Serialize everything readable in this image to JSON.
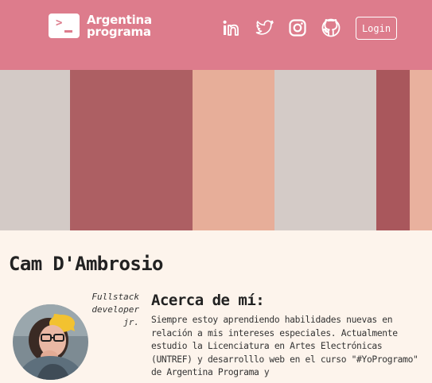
{
  "brand": {
    "line1": "Argentina",
    "line2": "programa",
    "icon": "terminal-prompt-icon",
    "prompt_glyph": ">"
  },
  "nav": {
    "social": [
      {
        "name": "linkedin",
        "icon": "linkedin-icon"
      },
      {
        "name": "twitter",
        "icon": "twitter-icon"
      },
      {
        "name": "instagram",
        "icon": "instagram-icon"
      },
      {
        "name": "github",
        "icon": "github-icon"
      }
    ],
    "login_label": "Login"
  },
  "banner": {
    "stripe_colors": [
      "#d3cac6",
      "#ad5f63",
      "#e7ae99",
      "#d4cbc7",
      "#a9575c",
      "#e9b19e"
    ]
  },
  "profile": {
    "name": "Cam D'Ambrosio",
    "role": "Fullstack developer jr.",
    "about_title": "Acerca de mí:",
    "about_text": "Siempre estoy aprendiendo habilidades nuevas en relación a mis intereses especiales. Actualmente estudio la Licenciatura en Artes Electrónicas (UNTREF) y desarrolllo web en el curso \"#YoProgramo\" de Argentina Programa y"
  },
  "colors": {
    "header_bg": "#dd7c8c",
    "content_bg": "#fdf4ec"
  }
}
